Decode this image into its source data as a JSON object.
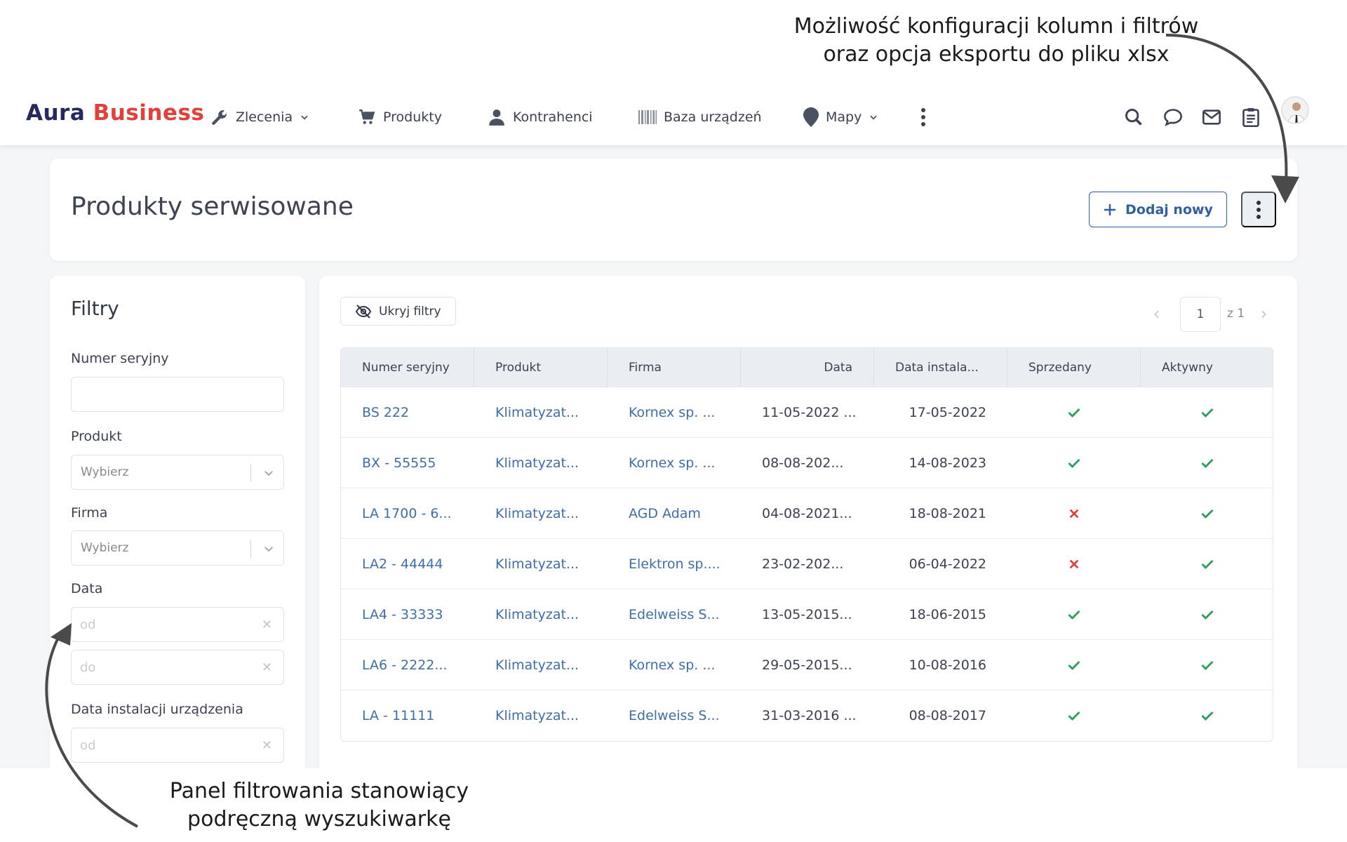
{
  "annotations": {
    "top_line1": "Możliwość konfiguracji kolumn i filtrów",
    "top_line2": "oraz opcja eksportu do pliku xlsx",
    "bottom_line1": "Panel filtrowania stanowiący",
    "bottom_line2": "podręczną wyszukiwarkę"
  },
  "navbar": {
    "logo_part1": "Aura",
    "logo_part2": "Business",
    "items": [
      {
        "label": "Zlecenia",
        "icon": "wrench-icon",
        "dropdown": true
      },
      {
        "label": "Produkty",
        "icon": "cart-icon",
        "dropdown": false
      },
      {
        "label": "Kontrahenci",
        "icon": "user-icon",
        "dropdown": false
      },
      {
        "label": "Baza urządzeń",
        "icon": "barcode-icon",
        "dropdown": false
      },
      {
        "label": "Mapy",
        "icon": "map-pin-icon",
        "dropdown": true
      }
    ],
    "right_icons": [
      "search-icon",
      "chat-icon",
      "mail-icon",
      "clipboard-icon"
    ]
  },
  "header": {
    "title": "Produkty serwisowane",
    "add_button": "Dodaj nowy"
  },
  "filters": {
    "title": "Filtry",
    "serial_label": "Numer seryjny",
    "product_label": "Produkt",
    "product_placeholder": "Wybierz",
    "company_label": "Firma",
    "company_placeholder": "Wybierz",
    "date_label": "Data",
    "date_from": "od",
    "date_to": "do",
    "install_date_label": "Data instalacji urządzenia",
    "install_from": "od"
  },
  "table": {
    "hide_filters": "Ukryj filtry",
    "pager": {
      "page": "1",
      "of": "z 1"
    },
    "columns": [
      "Numer seryjny",
      "Produkt",
      "Firma",
      "Data",
      "Data instala...",
      "Sprzedany",
      "Aktywny"
    ],
    "rows": [
      {
        "serial": "BS 222",
        "product": "Klimatyzat...",
        "company": "Kornex sp. ...",
        "date": "11-05-2022 ...",
        "install": "17-05-2022",
        "sold": true,
        "active": true
      },
      {
        "serial": "BX - 55555",
        "product": "Klimatyzat...",
        "company": "Kornex sp. ...",
        "date": "08-08-202...",
        "install": "14-08-2023",
        "sold": true,
        "active": true
      },
      {
        "serial": "LA 1700 - 6...",
        "product": "Klimatyzat...",
        "company": "AGD Adam",
        "date": "04-08-2021...",
        "install": "18-08-2021",
        "sold": false,
        "active": true
      },
      {
        "serial": "LA2 - 44444",
        "product": "Klimatyzat...",
        "company": "Elektron sp....",
        "date": "23-02-202...",
        "install": "06-04-2022",
        "sold": false,
        "active": true
      },
      {
        "serial": "LA4 - 33333",
        "product": "Klimatyzat...",
        "company": "Edelweiss S...",
        "date": "13-05-2015...",
        "install": "18-06-2015",
        "sold": true,
        "active": true
      },
      {
        "serial": "LA6 - 2222...",
        "product": "Klimatyzat...",
        "company": "Kornex sp. ...",
        "date": "29-05-2015...",
        "install": "10-08-2016",
        "sold": true,
        "active": true
      },
      {
        "serial": "LA - 11111",
        "product": "Klimatyzat...",
        "company": "Edelweiss S...",
        "date": "31-03-2016 ...",
        "install": "08-08-2017",
        "sold": true,
        "active": true
      }
    ]
  },
  "colors": {
    "accent": "#2f5f9e",
    "link": "#3e6ea8",
    "check": "#2e9e5e",
    "cross": "#e03a3a",
    "logo_dark": "#27295e",
    "logo_red": "#e2403a"
  }
}
